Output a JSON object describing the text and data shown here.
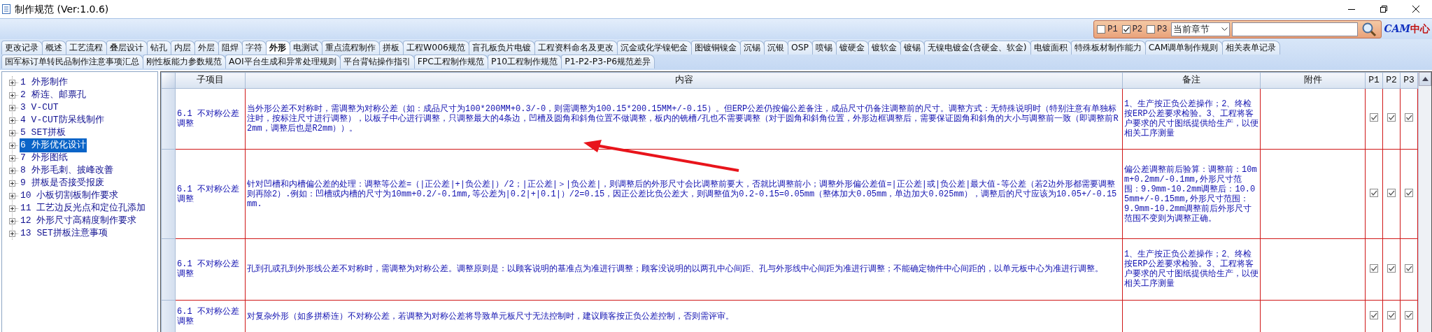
{
  "window": {
    "title": "制作规范 (Ver:1.0.6)"
  },
  "toolbar": {
    "filters": [
      {
        "label": "P1",
        "checked": false
      },
      {
        "label": "P2",
        "checked": true
      },
      {
        "label": "P3",
        "checked": false
      }
    ],
    "scope_select": {
      "value": "当前章节"
    },
    "logo": [
      {
        "text": "CAM",
        "kind": "latin"
      },
      {
        "text": "中心",
        "kind": "cjk"
      }
    ]
  },
  "tabs": [
    [
      {
        "label": "更改记录",
        "selected": false
      },
      {
        "label": "概述",
        "selected": false
      },
      {
        "label": "工艺流程",
        "selected": false
      },
      {
        "label": "叠层设计",
        "selected": false
      },
      {
        "label": "钻孔",
        "selected": false
      },
      {
        "label": "内层",
        "selected": false
      },
      {
        "label": "外层",
        "selected": false
      },
      {
        "label": "阻焊",
        "selected": false
      },
      {
        "label": "字符",
        "selected": false
      },
      {
        "label": "外形",
        "selected": true
      },
      {
        "label": "电测试",
        "selected": false
      },
      {
        "label": "重点流程制作",
        "selected": false
      },
      {
        "label": "拼板",
        "selected": false
      },
      {
        "label": "工程W006规范",
        "selected": false
      },
      {
        "label": "盲孔板负片电镀",
        "selected": false
      },
      {
        "label": "工程资料命名及更改",
        "selected": false
      },
      {
        "label": "沉金或化学镍钯金",
        "selected": false
      },
      {
        "label": "图镀铜镍金",
        "selected": false
      },
      {
        "label": "沉锡",
        "selected": false
      },
      {
        "label": "沉银",
        "selected": false
      },
      {
        "label": "OSP",
        "selected": false
      },
      {
        "label": "喷锡",
        "selected": false
      },
      {
        "label": "镀硬金",
        "selected": false
      },
      {
        "label": "镀软金",
        "selected": false
      },
      {
        "label": "镀锡",
        "selected": false
      },
      {
        "label": "无镍电镀金(含硬金、软金)",
        "selected": false
      },
      {
        "label": "电镀面积",
        "selected": false
      },
      {
        "label": "特殊板材制作能力",
        "selected": false
      },
      {
        "label": "CAM调单制作规则",
        "selected": false
      },
      {
        "label": "相关表单记录",
        "selected": false
      }
    ],
    [
      {
        "label": "国军标订单转民品制作注意事项汇总",
        "selected": false
      },
      {
        "label": "刚性板能力参数规范",
        "selected": false
      },
      {
        "label": "AOI平台生成和异常处理规则",
        "selected": false
      },
      {
        "label": "平台背钻操作指引",
        "selected": false
      },
      {
        "label": "FPC工程制作规范",
        "selected": false
      },
      {
        "label": "P10工程制作规范",
        "selected": false
      },
      {
        "label": "P1-P2-P3-P6规范差异",
        "selected": false
      }
    ]
  ],
  "tree": {
    "items": [
      {
        "label": "1 外形制作",
        "selected": false,
        "expanded": false
      },
      {
        "label": "2 桥连、邮票孔",
        "selected": false,
        "expanded": false
      },
      {
        "label": "3 V-CUT",
        "selected": false,
        "expanded": false
      },
      {
        "label": "4 V-CUT防呆线制作",
        "selected": false,
        "expanded": false
      },
      {
        "label": "5 SET拼板",
        "selected": false,
        "expanded": false
      },
      {
        "label": "6 外形优化设计",
        "selected": true,
        "expanded": false
      },
      {
        "label": "7 外形图纸",
        "selected": false,
        "expanded": false
      },
      {
        "label": "8 外形毛刺、披峰改善",
        "selected": false,
        "expanded": false
      },
      {
        "label": "9 拼板是否接受报废",
        "selected": false,
        "expanded": false
      },
      {
        "label": "10 小板切割板制作要求",
        "selected": false,
        "expanded": false
      },
      {
        "label": "11 工艺边反光点和定位孔添加",
        "selected": false,
        "expanded": false
      },
      {
        "label": "12 外形尺寸高精度制作要求",
        "selected": false,
        "expanded": false
      },
      {
        "label": "13 SET拼板注意事项",
        "selected": false,
        "expanded": false
      }
    ]
  },
  "table": {
    "columns": [
      "子项目",
      "内容",
      "备注",
      "附件",
      "P1",
      "P2",
      "P3"
    ],
    "rows": [
      {
        "sub_item": "6.1 不对称公差调整",
        "content": "当外形公差不对称时，需调整为对称公差（如：成品尺寸为100*200MM+0.3/-0，则需调整为100.15*200.15MM+/-0.15）。但ERP公差仍按偏公差备注，成品尺寸仍备注调整前的尺寸。调整方式：无特殊说明时（特别注意有单独标注时，按标注尺寸进行调整），以板子中心进行调整，只调整最大的4条边，凹槽及圆角和斜角位置不做调整，板内的铣槽/孔也不需要调整（对于圆角和斜角位置，外形边框调整后，需要保证圆角和斜角的大小与调整前一致（即调整前R2mm，调整后也是R2mm））。",
        "notes": "1、生产按正负公差操作；2、终检按ERP公差要求检验。3、工程将客户要求的尺寸图纸提供给生产，以便相关工序测量",
        "checks": [
          true,
          true,
          true
        ]
      },
      {
        "sub_item": "6.1 不对称公差调整",
        "content": "针对凹槽和内槽偏公差的处理：调整等公差=（|正公差|+|负公差|）/2；|正公差|＞|负公差|，则调整后的外形尺寸会比调整前要大，否就比调整前小；调整外形偏公差值=|正公差|或|负公差|最大值-等公差（若2边外形都需要调整则再除2）.例如：凹槽或内槽的尺寸为10mm+0.2/-0.1mm,等公差为|0.2|+|0.1|）/2=0.15，因正公差比负公差大，则调整值为0.2-0.15=0.05mm（整体加大0.05mm，单边加大0.025mm），调整后的尺寸应该为10.05+/-0.15mm.",
        "notes": "偏公差调整前后验算：调整前：10mm+0.2mm/-0.1mm,外形尺寸范围：9.9mm-10.2mm调整后：10.05mm+/-0.15mm,外形尺寸范围：9.9mm-10.2mm调整前后外形尺寸范围不变则为调整正确。",
        "checks": [
          true,
          true,
          true
        ]
      },
      {
        "sub_item": "6.1 不对称公差调整",
        "content": "孔到孔或孔到外形线公差不对称时，需调整为对称公差。调整原则是：以顾客说明的基准点为准进行调整；顾客没说明的以两孔中心间距、孔与外形线中心间距为准进行调整；不能确定物件中心间距的，以单元板中心为准进行调整。",
        "notes": "1、生产按正负公差操作；2、终检按ERP公差要求检验。3、工程将客户要求的尺寸图纸提供给生产，以便相关工序测量",
        "checks": [
          true,
          true,
          true
        ]
      },
      {
        "sub_item": "6.1 不对称公差调整",
        "content": "对复杂外形（如多拼桥连）不对称公差，若调整为对称公差将导致单元板尺寸无法控制时，建议顾客按正负公差控制，否则需评审。",
        "checks": [
          true,
          true,
          true
        ]
      }
    ]
  }
}
